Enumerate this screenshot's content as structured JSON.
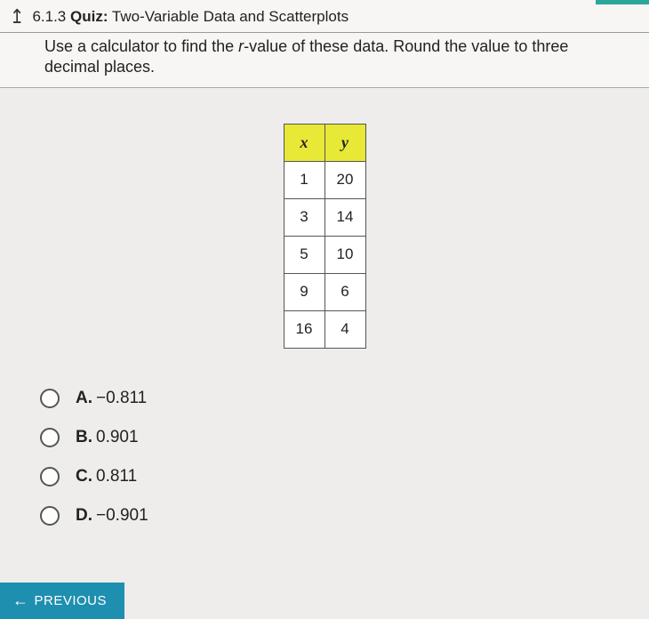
{
  "header": {
    "section_number": "6.1.3",
    "label_bold": "Quiz:",
    "title": "Two-Variable Data and Scatterplots"
  },
  "question": {
    "part1": "Use a calculator to find the ",
    "italic": "r",
    "part2": "-value of these data. Round the value to three decimal places."
  },
  "table": {
    "header_x": "x",
    "header_y": "y",
    "rows": [
      {
        "x": "1",
        "y": "20"
      },
      {
        "x": "3",
        "y": "14"
      },
      {
        "x": "5",
        "y": "10"
      },
      {
        "x": "9",
        "y": "6"
      },
      {
        "x": "16",
        "y": "4"
      }
    ]
  },
  "answers": [
    {
      "letter": "A.",
      "text": "−0.811"
    },
    {
      "letter": "B.",
      "text": "0.901"
    },
    {
      "letter": "C.",
      "text": "0.811"
    },
    {
      "letter": "D.",
      "text": "−0.901"
    }
  ],
  "nav": {
    "previous": "PREVIOUS"
  }
}
